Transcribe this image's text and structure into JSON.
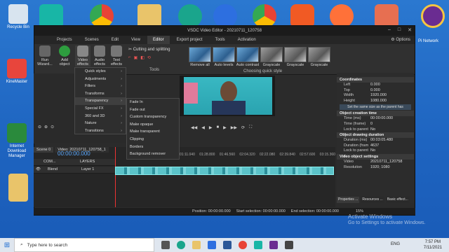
{
  "desktop": {
    "left_icons": [
      {
        "label": "Recycle Bin",
        "color": "#d8e4ef"
      },
      {
        "label": "KineMaster",
        "color": "#e8453c"
      },
      {
        "label": "Internet Download Manager",
        "color": "#2a8a3c"
      },
      {
        "label": "",
        "color": "#e9c46a"
      }
    ],
    "top_icons": [
      {
        "name": "filmora-icon",
        "color": "#18b6a6"
      },
      {
        "name": "chrome-icon",
        "color": "#eaeaea"
      },
      {
        "name": "folder-icon",
        "color": "#e9c46a"
      },
      {
        "name": "edge-icon",
        "color": "#1aa58c"
      },
      {
        "name": "app-icon",
        "color": "#2d6fe0"
      },
      {
        "name": "chrome-icon-2",
        "color": "#eaeaea"
      },
      {
        "name": "brave-icon",
        "color": "#f15a24"
      },
      {
        "name": "firefox-icon",
        "color": "#ff7139"
      },
      {
        "name": "app-icon-2",
        "color": "#e76f51"
      }
    ],
    "pi_network_label": "Pi Network"
  },
  "window": {
    "title": "VSDC Video Editor - 20210711_120758",
    "menu": [
      "Projects",
      "Scenes",
      "Edit",
      "View",
      "Editor",
      "Export project",
      "Tools",
      "Activation"
    ],
    "active_menu": "Editor",
    "options_label": "Options"
  },
  "ribbon": {
    "buttons": [
      {
        "label": "Run Wizard...",
        "color": "#666"
      },
      {
        "label": "Add object",
        "color": "#2e9e3f"
      },
      {
        "label": "Video effects",
        "color": "#888"
      },
      {
        "label": "Audio effects",
        "color": "#777"
      },
      {
        "label": "Text effects",
        "color": "#777"
      }
    ],
    "cutting_label": "Cutting and splitting",
    "tools_label": "Tools",
    "quick_styles": [
      "Remove all",
      "Auto levels",
      "Auto contrast",
      "Grayscale",
      "Grayscale",
      "Grayscale"
    ],
    "quick_style_group": "Choosing quick style"
  },
  "video_effects_menu": [
    "Quick styles",
    "Adjustments",
    "Filters",
    "Transforms",
    "Transparency",
    "Special FX",
    "360 and 3D",
    "Nature",
    "Transitions"
  ],
  "transparency_submenu": [
    "Fade In",
    "Fade out",
    "Custom transparency",
    "Make opaque",
    "Make transparent",
    "Clipping",
    "Borders",
    "Background remover"
  ],
  "timeline": {
    "tabs": [
      "Scene 0",
      "Video: 20210711_120758_1"
    ],
    "time": "00:00:00.000",
    "ruler": [
      "01:11.040",
      "01:28.800",
      "01:46.560",
      "02:04.320",
      "02:22.080",
      "02:39.840",
      "02:57.600",
      "03:15.360"
    ],
    "layers_label": "LAYERS",
    "track1_label": "COM...",
    "blend_label": "Blend",
    "layer1_label": "Layer 1"
  },
  "properties": {
    "section_coords": "Coordinates",
    "coords": [
      {
        "k": "Left",
        "v": "0.000"
      },
      {
        "k": "Top",
        "v": "0.000"
      },
      {
        "k": "Width",
        "v": "1920.000"
      },
      {
        "k": "Height",
        "v": "1080.000"
      }
    ],
    "same_size_btn": "Set the same size as the parent has",
    "section_creation": "Object creation time",
    "creation": [
      {
        "k": "Time (ms)",
        "v": "00:00:00.000"
      },
      {
        "k": "Time (frame)",
        "v": "0"
      },
      {
        "k": "Lock to parent c",
        "v": "No"
      }
    ],
    "section_duration": "Object drawing duration",
    "duration": [
      {
        "k": "Duration (ms)",
        "v": "00:03:05.480"
      },
      {
        "k": "Duration (fram",
        "v": "4637"
      },
      {
        "k": "Lock to parent c",
        "v": "No"
      }
    ],
    "section_video": "Video object settings",
    "video": [
      {
        "k": "Video",
        "v": "20210711_120758"
      },
      {
        "k": "Resolution",
        "v": "1920; 1080"
      }
    ],
    "tabs": [
      "Properties ...",
      "Resources ...",
      "Basic effect..."
    ]
  },
  "statusbar": {
    "position": "Position:  00:00:00.000",
    "start": "Start selection:  00:00:00.000",
    "end": "End selection:  00:00:00.000",
    "zoom": "15%"
  },
  "watermark": {
    "line1": "Activate Windows",
    "line2": "Go to Settings to activate Windows."
  },
  "taskbar": {
    "search_placeholder": "Type here to search",
    "time": "7:57 PM",
    "date": "7/11/2021",
    "lang": "ENG"
  }
}
